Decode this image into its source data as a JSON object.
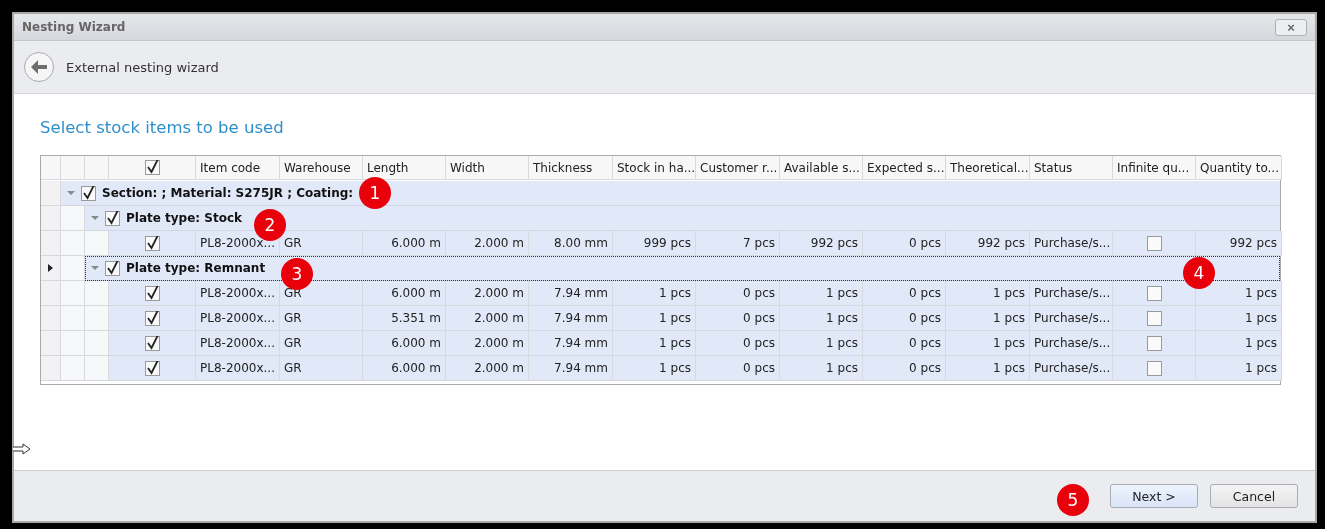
{
  "window": {
    "title": "Nesting Wizard",
    "close": "×"
  },
  "header": {
    "title": "External nesting wizard"
  },
  "page_title": "Select stock items to be used",
  "table": {
    "header_checked": true,
    "columns": [
      "Item code",
      "Warehouse",
      "Length",
      "Width",
      "Thickness",
      "Stock in ha...",
      "Customer r...",
      "Available s...",
      "Expected s...",
      "Theoretical...",
      "Status",
      "Infinite qu...",
      "Quantity to..."
    ],
    "groups": [
      {
        "label": "Section:  ; Material: S275JR ; Coating:",
        "checked": true,
        "expanded": true,
        "children": [
          {
            "label": "Plate type: Stock",
            "checked": true,
            "expanded": true,
            "focused": false,
            "rows": [
              {
                "checked": true,
                "infinite": false,
                "cells": [
                  "PL8-2000x...",
                  "GR",
                  "6.000 m",
                  "2.000 m",
                  "8.00 mm",
                  "999 pcs",
                  "7 pcs",
                  "992 pcs",
                  "0 pcs",
                  "992 pcs",
                  "Purchase/s...",
                  "992 pcs"
                ]
              }
            ]
          },
          {
            "label": "Plate type: Remnant",
            "checked": true,
            "expanded": true,
            "focused": true,
            "rows": [
              {
                "checked": true,
                "infinite": false,
                "cells": [
                  "PL8-2000x...",
                  "GR",
                  "6.000 m",
                  "2.000 m",
                  "7.94 mm",
                  "1 pcs",
                  "0 pcs",
                  "1 pcs",
                  "0 pcs",
                  "1 pcs",
                  "Purchase/s...",
                  "1 pcs"
                ]
              },
              {
                "checked": true,
                "infinite": false,
                "cells": [
                  "PL8-2000x...",
                  "GR",
                  "5.351 m",
                  "2.000 m",
                  "7.94 mm",
                  "1 pcs",
                  "0 pcs",
                  "1 pcs",
                  "0 pcs",
                  "1 pcs",
                  "Purchase/s...",
                  "1 pcs"
                ]
              },
              {
                "checked": true,
                "infinite": false,
                "cells": [
                  "PL8-2000x...",
                  "GR",
                  "6.000 m",
                  "2.000 m",
                  "7.94 mm",
                  "1 pcs",
                  "0 pcs",
                  "1 pcs",
                  "0 pcs",
                  "1 pcs",
                  "Purchase/s...",
                  "1 pcs"
                ]
              },
              {
                "checked": true,
                "infinite": false,
                "cells": [
                  "PL8-2000x...",
                  "GR",
                  "6.000 m",
                  "2.000 m",
                  "7.94 mm",
                  "1 pcs",
                  "0 pcs",
                  "1 pcs",
                  "0 pcs",
                  "1 pcs",
                  "Purchase/s...",
                  "1 pcs"
                ]
              }
            ]
          }
        ]
      }
    ]
  },
  "buttons": [
    {
      "label": "Next >",
      "primary": true
    },
    {
      "label": "Cancel",
      "primary": false
    }
  ],
  "callouts": [
    "1",
    "2",
    "3",
    "4",
    "5"
  ]
}
